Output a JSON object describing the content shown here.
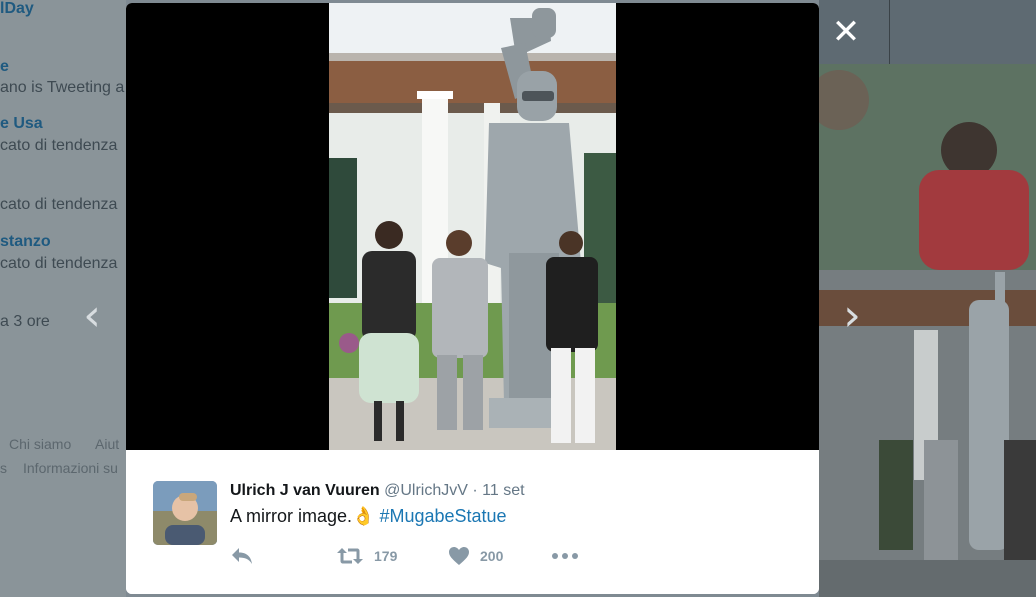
{
  "background": {
    "trends": [
      {
        "text": "lDay",
        "kind": "title"
      },
      {
        "text": "e",
        "kind": "title"
      },
      {
        "text": "ano is Tweeting a",
        "kind": "sub"
      },
      {
        "text": "e Usa",
        "kind": "title"
      },
      {
        "text": "cato di tendenza",
        "kind": "sub"
      },
      {
        "text": "cato di tendenza",
        "kind": "sub"
      },
      {
        "text": "stanzo",
        "kind": "title"
      },
      {
        "text": "cato di tendenza",
        "kind": "sub"
      },
      {
        "text": "a 3 ore",
        "kind": "sub"
      }
    ],
    "footer": {
      "about": "Chi siamo",
      "help": "Aiut",
      "s": "s",
      "info": "Informazioni su"
    }
  },
  "viewer": {
    "close_glyph": "✕",
    "prev_glyph": "‹",
    "next_glyph": "›"
  },
  "tweet": {
    "author_name": "Ulrich J van Vuuren",
    "handle": "@UlrichJvV",
    "separator": "·",
    "date": "11 set",
    "text": "A mirror image.",
    "emoji": "👌",
    "hashtag": "#MugabeStatue",
    "retweets": "179",
    "likes": "200"
  },
  "icons": {
    "reply": "reply-icon",
    "retweet": "retweet-icon",
    "like": "heart-icon",
    "more": "more-icon",
    "close": "close-icon"
  },
  "colors": {
    "accent": "#1b77b3",
    "text": "#14171a",
    "meta": "#657786",
    "action": "#8899a6"
  }
}
